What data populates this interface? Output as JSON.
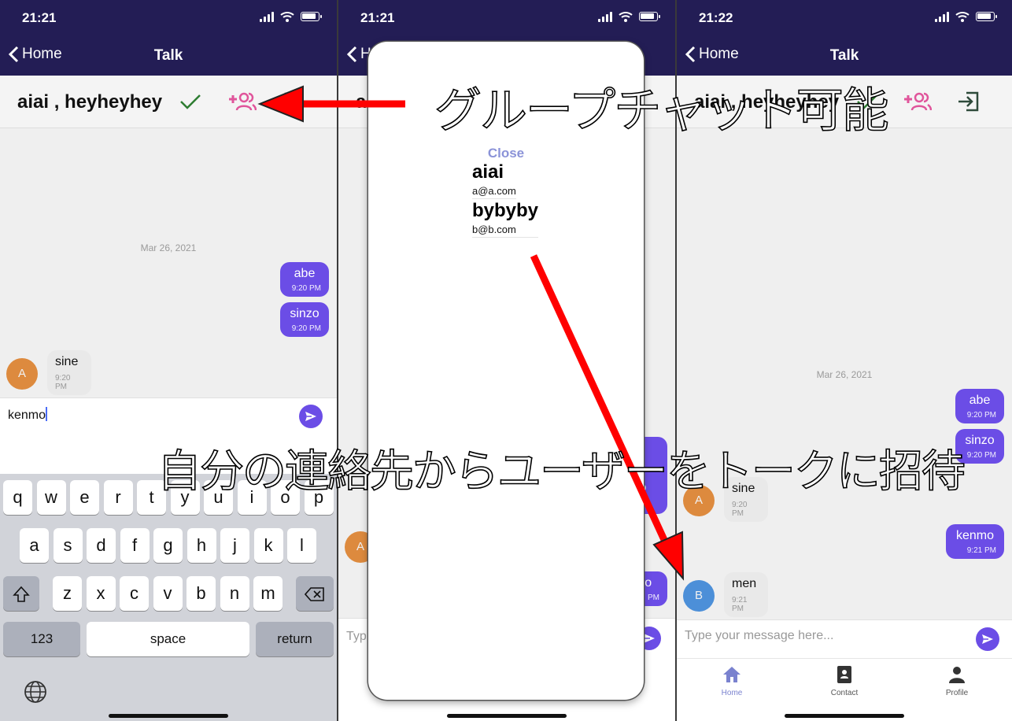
{
  "panels": [
    {
      "status_time": "21:21",
      "nav_back": "Home",
      "nav_title": "Talk",
      "chat_title": "aiai , heyheyhey",
      "date": "Mar 26, 2021",
      "messages_out": [
        {
          "text": "abe",
          "time": "9:20 PM"
        },
        {
          "text": "sinzo",
          "time": "9:20 PM"
        }
      ],
      "message_in": {
        "avatar": "A",
        "text": "sine",
        "time": "9:20 PM"
      },
      "input_value": "kenmo"
    },
    {
      "status_time": "21:21",
      "nav_back_partial": "H",
      "header_partial": "ai",
      "bubble_partial_1": "o",
      "bubble_partial_2": "mo",
      "time_partial": "PM",
      "avatar_partial": "A",
      "input_partial": "Typ"
    },
    {
      "status_time": "21:22",
      "nav_back": "Home",
      "nav_title": "Talk",
      "chat_title": "aiai , heyheyhey",
      "date": "Mar 26, 2021",
      "messages_out": [
        {
          "text": "abe",
          "time": "9:20 PM"
        },
        {
          "text": "sinzo",
          "time": "9:20 PM"
        },
        {
          "text": "kenmo",
          "time": "9:21 PM"
        }
      ],
      "messages_in": [
        {
          "avatar": "A",
          "text": "sine",
          "time": "9:20 PM"
        },
        {
          "avatar": "B",
          "text": "men",
          "time": "9:21 PM"
        }
      ],
      "input_placeholder": "Type your message here...",
      "tabs": [
        "Home",
        "Contact",
        "Profile"
      ]
    }
  ],
  "keyboard": {
    "row1": [
      "q",
      "w",
      "e",
      "r",
      "t",
      "y",
      "u",
      "i",
      "o",
      "p"
    ],
    "row2": [
      "a",
      "s",
      "d",
      "f",
      "g",
      "h",
      "j",
      "k",
      "l"
    ],
    "row3": [
      "z",
      "x",
      "c",
      "v",
      "b",
      "n",
      "m"
    ],
    "numbers": "123",
    "space": "space",
    "return": "return"
  },
  "modal": {
    "close_label": "Close",
    "contacts": [
      {
        "name": "aiai",
        "email": "a@a.com"
      },
      {
        "name": "bybyby",
        "email": "b@b.com"
      }
    ]
  },
  "annotations": {
    "group_chat": "グループチャット可能",
    "invite": "自分の連絡先からユーザーをトークに招待"
  },
  "colors": {
    "navbar": "#231d55",
    "accent": "#6b4de6",
    "check": "#2e7d32",
    "add_user": "#e0559b",
    "arrow": "#ff0000"
  }
}
